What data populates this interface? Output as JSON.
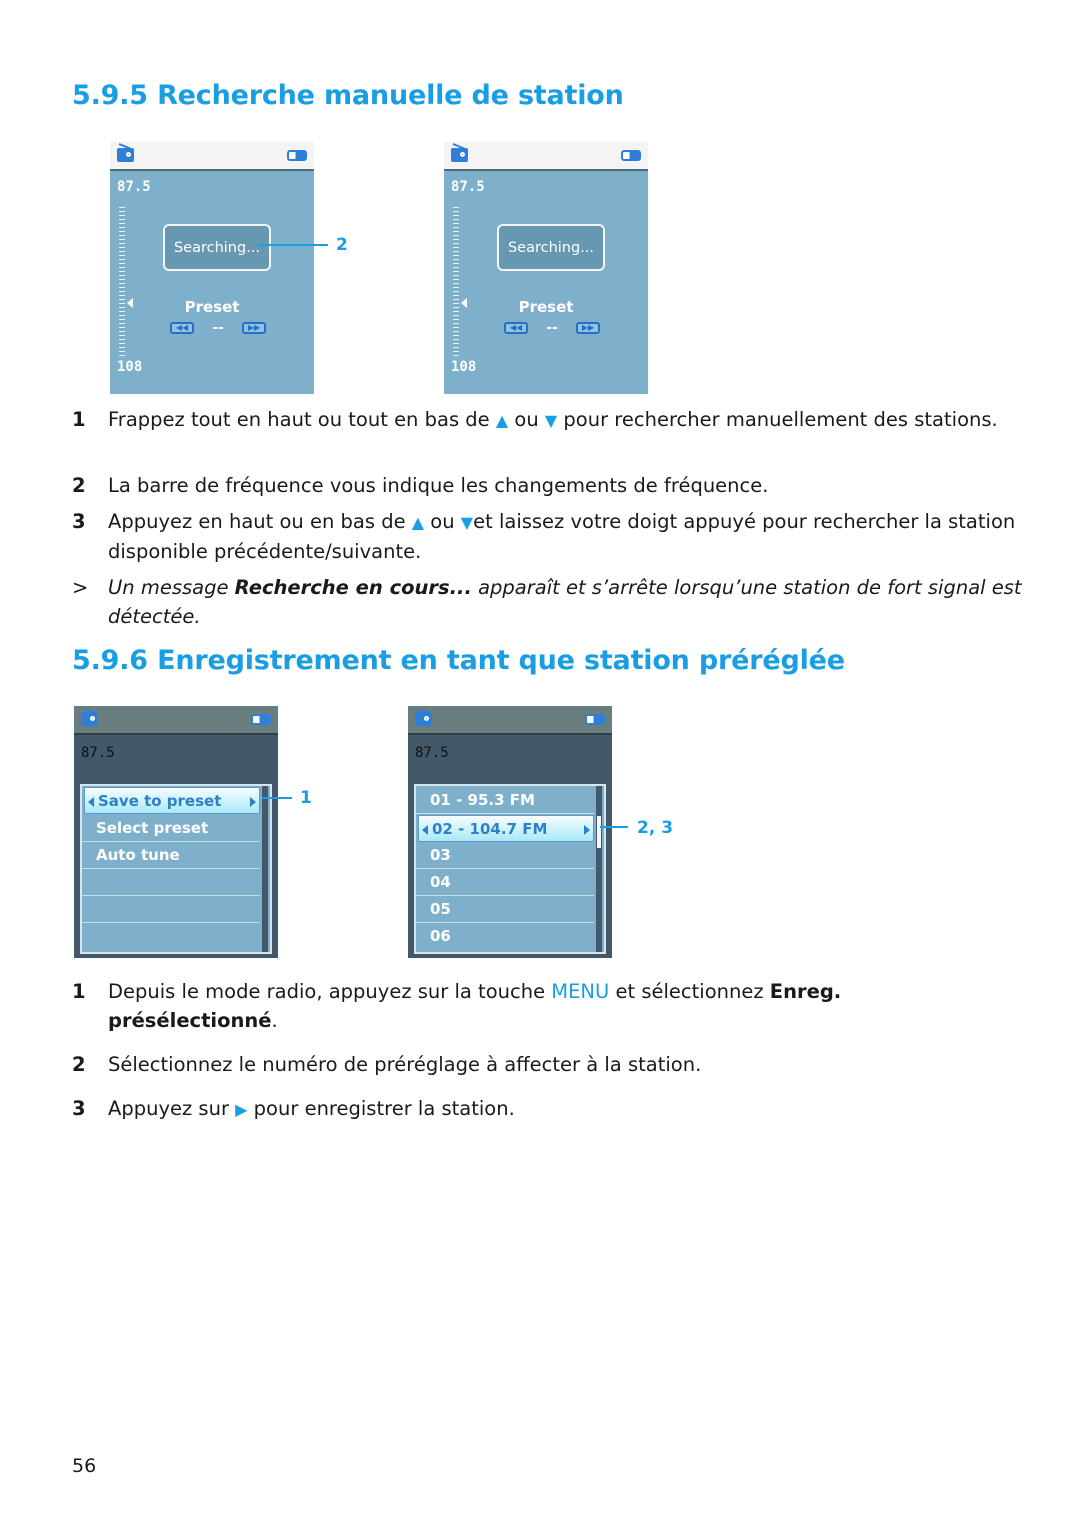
{
  "section1": {
    "heading": "5.9.5 Recherche manuelle de station",
    "screens": [
      {
        "frequency_top": "87.5",
        "frequency_bottom": "108",
        "message": "Searching...",
        "preset_label": "Preset",
        "preset_value": "--",
        "callout": "2"
      },
      {
        "frequency_top": "87.5",
        "frequency_bottom": "108",
        "message": "Searching...",
        "preset_label": "Preset",
        "preset_value": "--"
      }
    ],
    "steps": [
      {
        "num": "1",
        "pre": "Frappez tout en haut ou tout en bas de ",
        "up": "▲",
        "mid": " ou ",
        "down": "▼",
        "post": " pour rechercher manuellement des stations."
      },
      {
        "num": "2",
        "text": "La barre de fréquence vous indique les changements de fréquence."
      },
      {
        "num": "3",
        "pre": "Appuyez en haut ou en bas de ",
        "up": "▲",
        "mid": " ou ",
        "down": "▼",
        "post": "et laissez votre doigt appuyé pour rechercher la station disponible précédente/suivante."
      }
    ],
    "note": {
      "marker": ">",
      "pre": "Un message ",
      "bold": "Recherche en cours...",
      "post": " apparaît et s’arrête lorsqu’une station de fort signal est détectée."
    }
  },
  "section2": {
    "heading": "5.9.6 Enregistrement en tant que station préréglée",
    "menu_screen": {
      "frequency": "87.5",
      "items": [
        "Save to preset",
        "Select preset",
        "Auto tune",
        "",
        "",
        ""
      ],
      "selected_index": 0,
      "callout": "1"
    },
    "preset_screen": {
      "frequency": "87.5",
      "items": [
        "01 - 95.3 FM",
        "02 - 104.7 FM",
        "03",
        "04",
        "05",
        "06"
      ],
      "selected_index": 1,
      "callout": "2, 3"
    },
    "steps": [
      {
        "num": "1",
        "pre": "Depuis le mode radio, appuyez sur la touche ",
        "key": "MENU",
        "mid": " et sélectionnez ",
        "bold": "Enreg. présélectionné",
        "post": "."
      },
      {
        "num": "2",
        "text": "Sélectionnez le numéro de préréglage à affecter à la station."
      },
      {
        "num": "3",
        "pre": "Appuyez sur ",
        "icon": "▶",
        "post": " pour enregistrer la station."
      }
    ]
  },
  "page_number": "56"
}
